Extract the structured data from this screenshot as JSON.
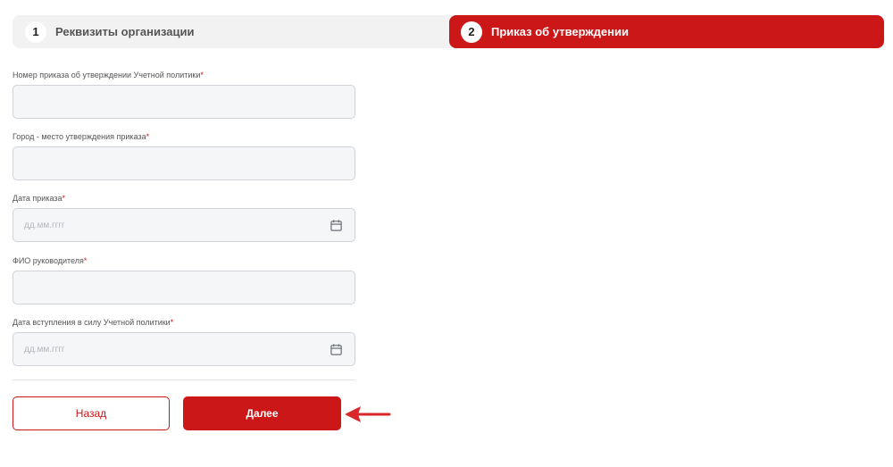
{
  "stepper": {
    "steps": [
      {
        "number": "1",
        "label": "Реквизиты организации",
        "active": false
      },
      {
        "number": "2",
        "label": "Приказ об утверждении",
        "active": true
      }
    ]
  },
  "form": {
    "required_mark": "*",
    "fields": [
      {
        "label": "Номер приказа об утверждении Учетной политики",
        "value": "",
        "placeholder": "",
        "type": "text"
      },
      {
        "label": "Город - место утверждения приказа",
        "value": "",
        "placeholder": "",
        "type": "text"
      },
      {
        "label": "Дата приказа",
        "value": "",
        "placeholder": "дд.мм.гггг",
        "type": "date",
        "icon": "calendar-icon"
      },
      {
        "label": "ФИО руководителя",
        "value": "",
        "placeholder": "",
        "type": "text"
      },
      {
        "label": "Дата вступления в силу Учетной политики",
        "value": "",
        "placeholder": "дд.мм.гггг",
        "type": "date",
        "icon": "calendar-icon"
      }
    ]
  },
  "buttons": {
    "back_label": "Назад",
    "next_label": "Далее"
  },
  "annotation": {
    "icon": "red-arrow-pointing-left",
    "color": "#d9272a"
  },
  "colors": {
    "accent": "#cc1719",
    "stepper_bg": "#f2f2f3",
    "input_bg": "#f5f6f8",
    "input_border": "#d0d3d8"
  }
}
